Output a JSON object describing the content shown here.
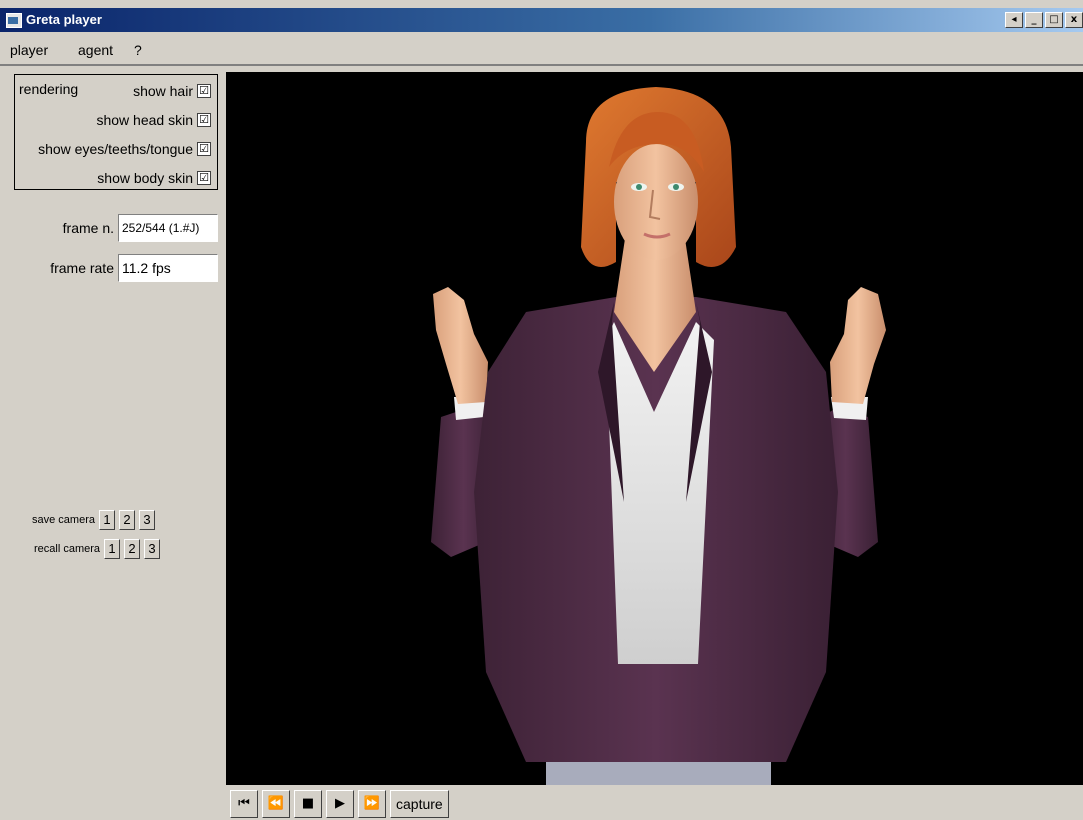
{
  "window": {
    "title": "Greta player",
    "buttons": [
      "◂",
      "_",
      "□",
      "x"
    ]
  },
  "menu": {
    "items": [
      "player",
      "agent",
      "?"
    ]
  },
  "rendering": {
    "title": "rendering",
    "options": [
      {
        "label": "show hair",
        "checked": "☑"
      },
      {
        "label": "show head skin",
        "checked": "☑"
      },
      {
        "label": "show eyes/teeths/tongue",
        "checked": "☑"
      },
      {
        "label": "show body skin",
        "checked": "☑"
      }
    ]
  },
  "frame": {
    "label": "frame n.",
    "value": "252/544 (1.#J)",
    "rate_label": "frame rate",
    "rate_value": "11.2 fps"
  },
  "camera": {
    "save_label": "save camera",
    "recall_label": "recall camera",
    "slots": [
      "1",
      "2",
      "3"
    ]
  },
  "transport": {
    "first": "⏮",
    "rewind": "⏪",
    "stop": "■",
    "play": "▶",
    "forward": "⏩",
    "capture": "capture"
  }
}
